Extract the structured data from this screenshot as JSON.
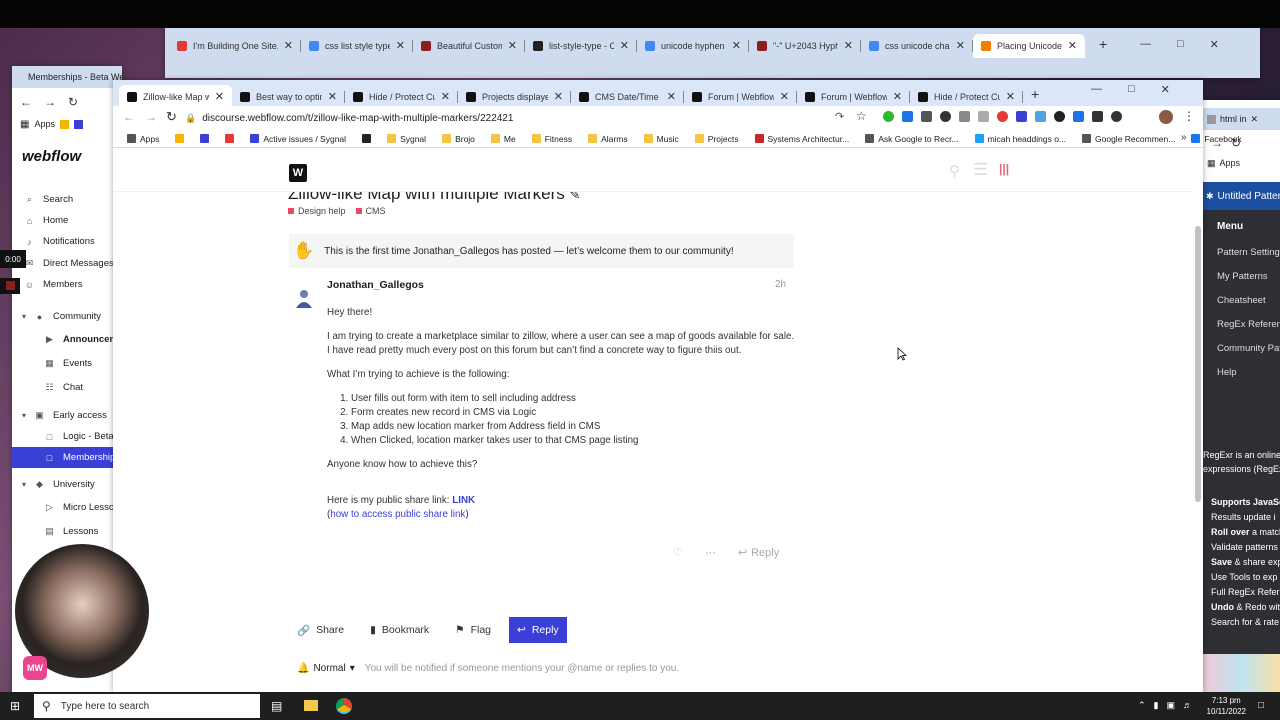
{
  "screen": {
    "clock_time": "7:13 pm",
    "clock_date": "10/11/2022",
    "video_timer": "0:00"
  },
  "back_window": {
    "tabs": [
      {
        "title": "I'm Building One Site, for Me",
        "color": "#e53935"
      },
      {
        "title": "css list style type c...",
        "color": "#4285f4"
      },
      {
        "title": "Beautiful Custom L...",
        "color": "#8e1c1c"
      },
      {
        "title": "list-style-type - CSS...",
        "color": "#222222"
      },
      {
        "title": "unicode hyphen bu...",
        "color": "#4285f4"
      },
      {
        "title": "\"-\" U+2043 Hyphe...",
        "color": "#8e1c1c"
      },
      {
        "title": "css unicode char -...",
        "color": "#4285f4"
      },
      {
        "title": "Placing Unicode ch...",
        "color": "#f57c00"
      }
    ]
  },
  "left_window": {
    "tab_title": "Memberships - Beta Webflow",
    "brand": "webflow",
    "bookmarks_apps": "Apps",
    "nav": [
      {
        "label": "Search",
        "icon": "search-icon"
      },
      {
        "label": "Home",
        "icon": "home-icon"
      },
      {
        "label": "Notifications",
        "icon": "bell-icon"
      },
      {
        "label": "Direct Messages",
        "icon": "message-icon"
      },
      {
        "label": "Members",
        "icon": "members-icon"
      },
      {
        "label": "Community",
        "icon": "community-icon",
        "group": true
      },
      {
        "label": "Announcem",
        "icon": "megaphone-icon",
        "bold": true
      },
      {
        "label": "Events",
        "icon": "calendar-icon"
      },
      {
        "label": "Chat",
        "icon": "chat-icon"
      },
      {
        "label": "Early access",
        "icon": "lock-group-icon",
        "group": true
      },
      {
        "label": "Logic - Beta",
        "icon": "lock-icon"
      },
      {
        "label": "Memberships",
        "icon": "lock-icon",
        "selected": true
      },
      {
        "label": "University",
        "icon": "university-icon",
        "group": true
      },
      {
        "label": "Micro Lesson",
        "icon": "video-icon"
      },
      {
        "label": "Lessons",
        "icon": "book-icon"
      }
    ],
    "app_badge": "MW"
  },
  "main_window": {
    "tabs": [
      {
        "title": "Zillow-like Map with...",
        "active": true,
        "color": "#111111"
      },
      {
        "title": "Best way to optimiz...",
        "color": "#111111"
      },
      {
        "title": "Hide / Protect Cust...",
        "color": "#111111"
      },
      {
        "title": "Projects displayed ...",
        "color": "#111111"
      },
      {
        "title": "CMS Date/Time Co...",
        "color": "#111111"
      },
      {
        "title": "Forum | Webflow",
        "color": "#111111"
      },
      {
        "title": "Forum | Webflow",
        "color": "#111111"
      },
      {
        "title": "Hide / Protect Cust...",
        "color": "#111111"
      }
    ],
    "url": "discourse.webflow.com/t/zillow-like-map-with-multiple-markers/222421",
    "bookmarks": [
      {
        "label": "Apps",
        "color": "#555555"
      },
      {
        "label": "",
        "color": "#f4b400"
      },
      {
        "label": "",
        "color": "#3a3fd6"
      },
      {
        "label": "",
        "color": "#e53935"
      },
      {
        "label": "Active issues / Sygnal",
        "color": "#3a3fd6"
      },
      {
        "label": "",
        "color": "#222222"
      },
      {
        "label": "Sygnal",
        "color": "#f4c542"
      },
      {
        "label": "Brojo",
        "color": "#f4c542"
      },
      {
        "label": "Me",
        "color": "#f4c542"
      },
      {
        "label": "Fitness",
        "color": "#f4c542"
      },
      {
        "label": "Alarms",
        "color": "#f4c542"
      },
      {
        "label": "Music",
        "color": "#f4c542"
      },
      {
        "label": "Projects",
        "color": "#f4c542"
      },
      {
        "label": "Systems Architectur...",
        "color": "#c62828"
      },
      {
        "label": "Ask Google to Recr...",
        "color": "#555555"
      },
      {
        "label": "micah headdings o...",
        "color": "#1da1f2"
      },
      {
        "label": "Google Recommen...",
        "color": "#555555"
      },
      {
        "label": "Facebook",
        "color": "#1877f2"
      }
    ],
    "topic": {
      "title": "Zillow-like Map with multiple Markers",
      "categories": [
        {
          "label": "Design help",
          "color": "#e94a6b"
        },
        {
          "label": "CMS",
          "color": "#e94a6b"
        }
      ],
      "notice": "This is the first time Jonathan_Gallegos has posted — let’s welcome them to our community!",
      "author": "Jonathan_Gallegos",
      "time": "2h",
      "greeting": "Hey there!",
      "para1": "I am trying to create a marketplace similar to zillow, where a user can see a map of goods available for sale. I have read pretty much every post on this forum but can’t find a concrete way to figure thiis out.",
      "para2": "What I’m trying to achieve is the following:",
      "steps": [
        "User fills out form with item to sell including address",
        "Form creates new record in CMS via Logic",
        "Map adds new location marker from Address field in CMS",
        "When Clicked, location marker takes user to that CMS page listing"
      ],
      "para3": "Anyone know how to achieve this?",
      "share_prefix": "Here is my public share link: ",
      "share_link": "LINK",
      "share_help_open": "(",
      "share_help": "how to access public share link",
      "share_help_close": ")",
      "reply_small": "Reply",
      "buttons": {
        "share": "Share",
        "bookmark": "Bookmark",
        "flag": "Flag",
        "reply": "Reply"
      },
      "notification_level": "Normal",
      "notification_text": "You will be notified if someone mentions your @name or replies to you."
    }
  },
  "right_window": {
    "tab_title": "html in",
    "bookmarks_apps": "Apps",
    "app_title": "Untitled Pattern",
    "menu_title": "Menu",
    "menu": [
      "Pattern Setting",
      "My Patterns",
      "Cheatsheet",
      "RegEx Reference",
      "Community Pat",
      "Help"
    ],
    "intro_lines": [
      "RegExr is an online t",
      "expressions (RegEx"
    ],
    "features": [
      {
        "bold": "Supports JavaSc",
        "rest": ""
      },
      {
        "bold": "",
        "rest": "Results update i"
      },
      {
        "bold": "Roll over",
        "rest": " a match"
      },
      {
        "bold": "",
        "rest": "Validate patterns"
      },
      {
        "bold": "Save",
        "rest": " & share exp"
      },
      {
        "bold": "",
        "rest": "Use Tools to exp"
      },
      {
        "bold": "",
        "rest": "Full RegEx Refer"
      },
      {
        "bold": "Undo",
        "rest": " & Redo wit"
      },
      {
        "bold": "",
        "rest": "Search for & rate"
      }
    ]
  },
  "taskbar": {
    "search_placeholder": "Type here to search"
  }
}
